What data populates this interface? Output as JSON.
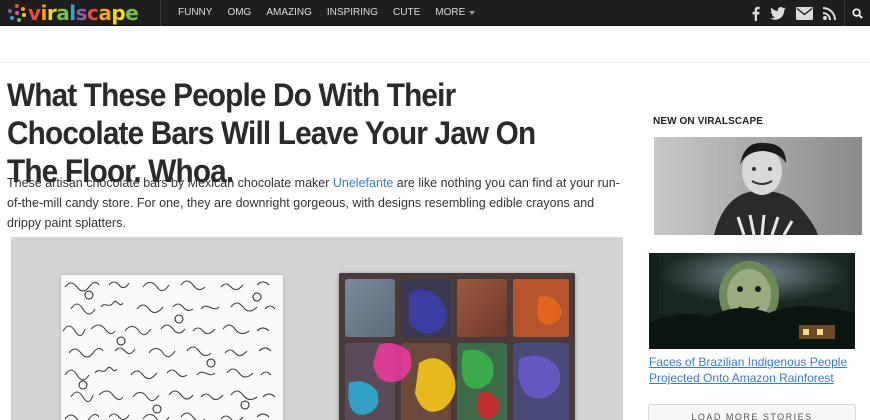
{
  "site": {
    "logo_text": "viralscape",
    "logo_colors": [
      "#e94b3c",
      "#f7a21b",
      "#f7d51d",
      "#7ac143",
      "#27a9e1",
      "#8b5ca8"
    ]
  },
  "nav": {
    "items": [
      "FUNNY",
      "OMG",
      "AMAZING",
      "INSPIRING",
      "CUTE"
    ],
    "more_label": "MORE"
  },
  "social_icons": [
    "facebook-icon",
    "twitter-icon",
    "email-icon",
    "rss-icon"
  ],
  "article": {
    "title": "What These People Do With Their Chocolate Bars Will Leave Your Jaw On The Floor. Whoa.",
    "intro_before": "These artisan chocolate bars by Mexican chocolate maker ",
    "intro_link": "Unelefante",
    "intro_after": " are like nothing you can find at your run-of-the-mill candy store. For one, they are downright gorgeous, with designs resembling edible crayons and drippy paint splatters."
  },
  "sidebar": {
    "heading": "NEW ON VIRALSCAPE",
    "story_caption": "Faces of Brazilian Indigenous People Projected Onto Amazon Rainforest",
    "load_more": "LOAD MORE STORIES"
  },
  "colors": {
    "topbar": "#1e1e1e",
    "link": "#3a7bd5",
    "headline": "#2a2a2a"
  }
}
